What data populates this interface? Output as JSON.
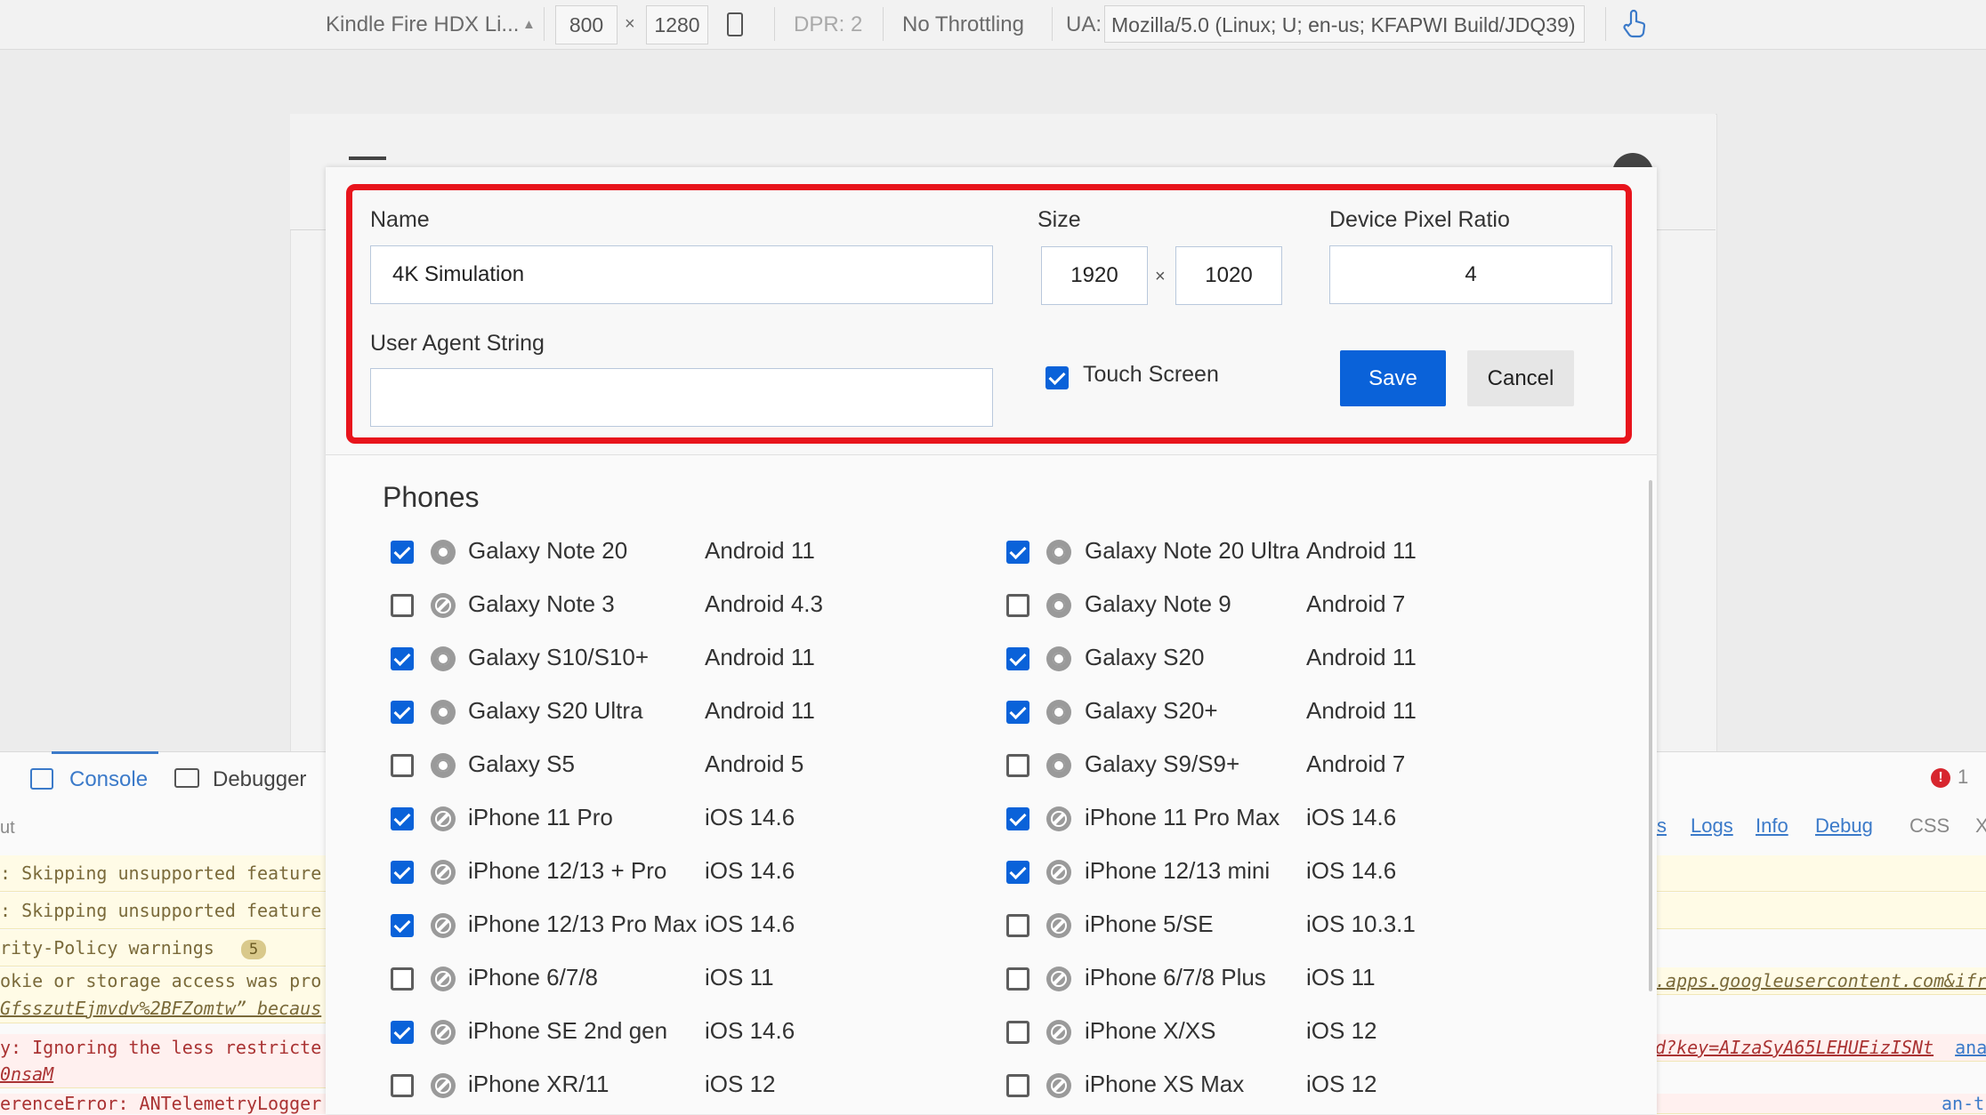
{
  "toolbar": {
    "device": "Kindle Fire HDX Li...",
    "width": "800",
    "times": "×",
    "height": "1280",
    "dpr": "DPR: 2",
    "throttling": "No Throttling",
    "ua_label": "UA:",
    "ua_value": "Mozilla/5.0 (Linux; U; en-us; KFAPWI Build/JDQ39)"
  },
  "devtools": {
    "console_tab": "Console",
    "debugger_tab": "Debugger",
    "left_fragment": "ut",
    "logs": [
      ": Skipping unsupported feature",
      ": Skipping unsupported feature",
      "rity-Policy warnings",
      "okie or storage access was pro",
      "GfsszutEjmvdv%2BFZomtw” becaus",
      "y: Ignoring the less restricte",
      "0nsaM",
      "erenceError: ANTelemetryLogger"
    ],
    "warnings_count": "5",
    "error_count": "1",
    "filters": [
      "s",
      "Logs",
      "Info",
      "Debug"
    ],
    "css_label": "CSS",
    "x_label": "X",
    "right_logs": [
      ".apps.googleusercontent.com&ifr",
      "d?key=AIzaSyA65LEHUEizISNt",
      "an-t"
    ],
    "right_link": "ana"
  },
  "form": {
    "name_label": "Name",
    "name_value": "4K Simulation",
    "size_label": "Size",
    "size_width": "1920",
    "size_times": "×",
    "size_height": "1020",
    "dpr_label": "Device Pixel Ratio",
    "dpr_value": "4",
    "ua_label": "User Agent String",
    "ua_value": "",
    "touch_label": "Touch Screen",
    "touch_checked": true,
    "save_label": "Save",
    "cancel_label": "Cancel"
  },
  "phones": {
    "heading": "Phones",
    "left": [
      {
        "name": "Galaxy Note 20",
        "os": "Android 11",
        "checked": true,
        "browser": "chrome"
      },
      {
        "name": "Galaxy Note 3",
        "os": "Android 4.3",
        "checked": false,
        "browser": "safari"
      },
      {
        "name": "Galaxy S10/S10+",
        "os": "Android 11",
        "checked": true,
        "browser": "chrome"
      },
      {
        "name": "Galaxy S20 Ultra",
        "os": "Android 11",
        "checked": true,
        "browser": "chrome"
      },
      {
        "name": "Galaxy S5",
        "os": "Android 5",
        "checked": false,
        "browser": "chrome"
      },
      {
        "name": "iPhone 11 Pro",
        "os": "iOS 14.6",
        "checked": true,
        "browser": "safari"
      },
      {
        "name": "iPhone 12/13 + Pro",
        "os": "iOS 14.6",
        "checked": true,
        "browser": "safari"
      },
      {
        "name": "iPhone 12/13 Pro Max",
        "os": "iOS 14.6",
        "checked": true,
        "browser": "safari"
      },
      {
        "name": "iPhone 6/7/8",
        "os": "iOS 11",
        "checked": false,
        "browser": "safari"
      },
      {
        "name": "iPhone SE 2nd gen",
        "os": "iOS 14.6",
        "checked": true,
        "browser": "safari"
      },
      {
        "name": "iPhone XR/11",
        "os": "iOS 12",
        "checked": false,
        "browser": "safari"
      }
    ],
    "right": [
      {
        "name": "Galaxy Note 20 Ultra",
        "os": "Android 11",
        "checked": true,
        "browser": "chrome"
      },
      {
        "name": "Galaxy Note 9",
        "os": "Android 7",
        "checked": false,
        "browser": "chrome"
      },
      {
        "name": "Galaxy S20",
        "os": "Android 11",
        "checked": true,
        "browser": "chrome"
      },
      {
        "name": "Galaxy S20+",
        "os": "Android 11",
        "checked": true,
        "browser": "chrome"
      },
      {
        "name": "Galaxy S9/S9+",
        "os": "Android 7",
        "checked": false,
        "browser": "chrome"
      },
      {
        "name": "iPhone 11 Pro Max",
        "os": "iOS 14.6",
        "checked": true,
        "browser": "safari"
      },
      {
        "name": "iPhone 12/13 mini",
        "os": "iOS 14.6",
        "checked": true,
        "browser": "safari"
      },
      {
        "name": "iPhone 5/SE",
        "os": "iOS 10.3.1",
        "checked": false,
        "browser": "safari"
      },
      {
        "name": "iPhone 6/7/8 Plus",
        "os": "iOS 11",
        "checked": false,
        "browser": "safari"
      },
      {
        "name": "iPhone X/XS",
        "os": "iOS 12",
        "checked": false,
        "browser": "safari"
      },
      {
        "name": "iPhone XS Max",
        "os": "iOS 12",
        "checked": false,
        "browser": "safari"
      }
    ]
  },
  "colors": {
    "accent": "#0a62d9",
    "highlight": "#e8141c"
  }
}
